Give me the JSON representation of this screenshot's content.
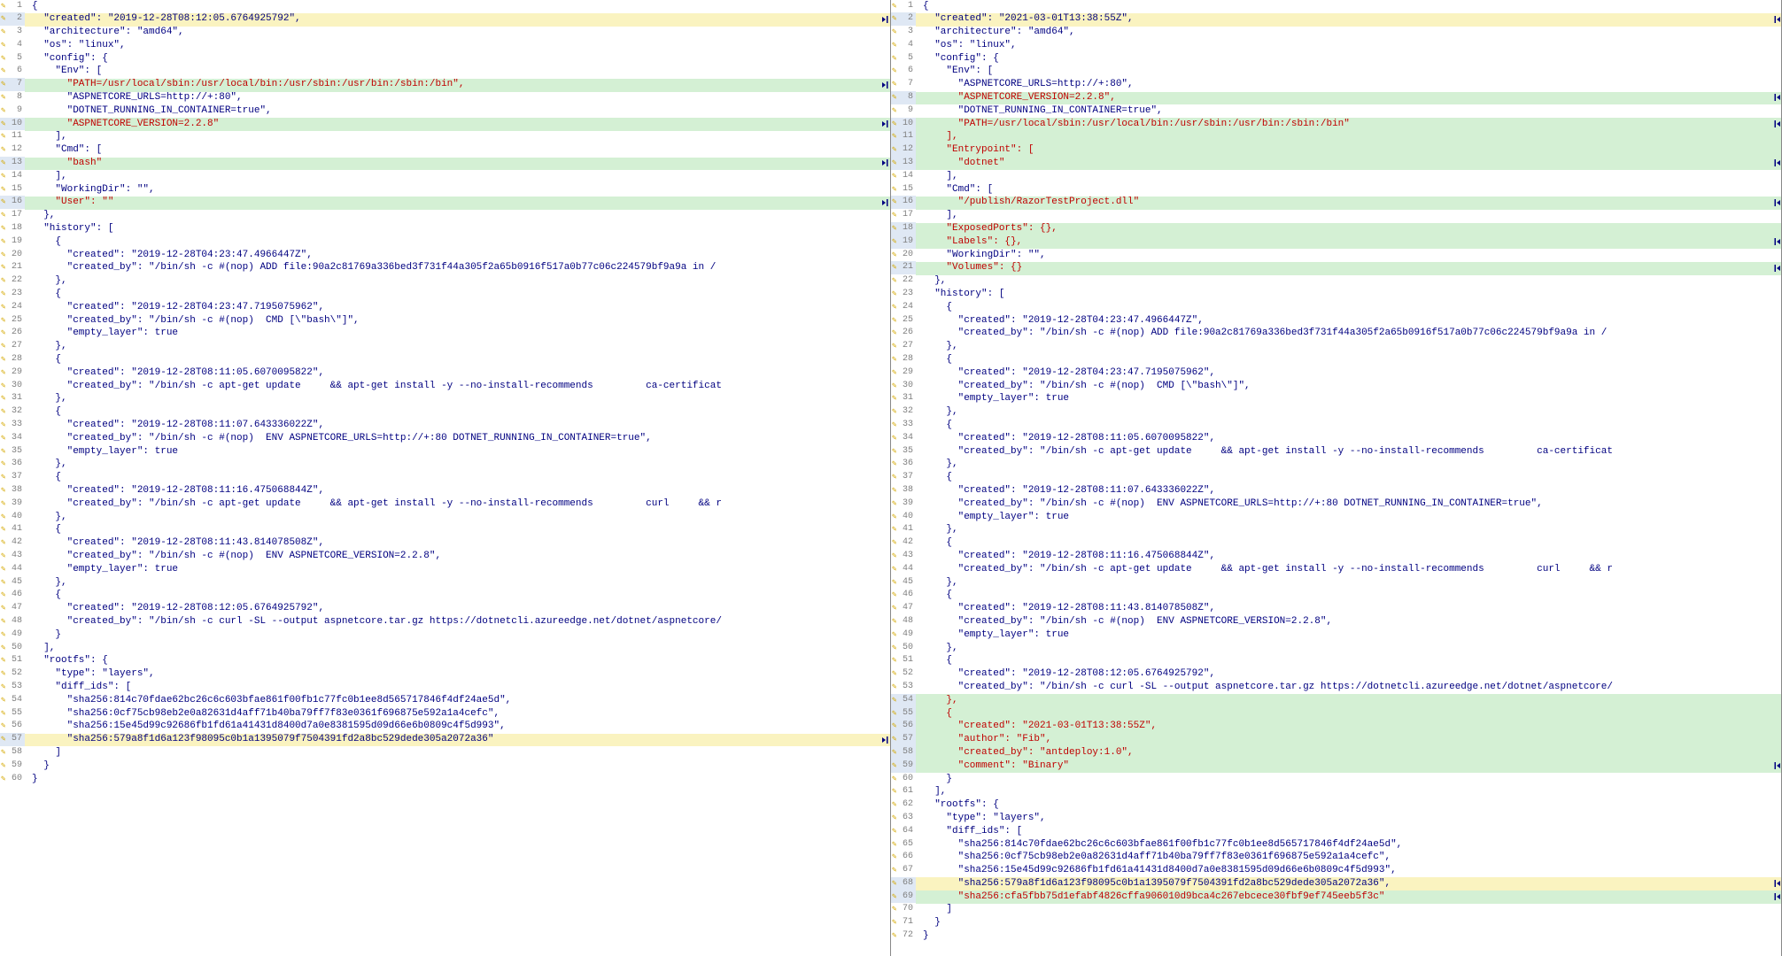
{
  "pencil_glyph": "✎",
  "left": {
    "lines": [
      {
        "n": 1,
        "t": "{",
        "s": "norm"
      },
      {
        "n": 2,
        "t": "  \"created\": \"2019-12-28T08:12:05.6764925792\",",
        "s": "mod",
        "mk": "r"
      },
      {
        "n": 3,
        "t": "  \"architecture\": \"amd64\",",
        "s": "norm"
      },
      {
        "n": 4,
        "t": "  \"os\": \"linux\",",
        "s": "norm"
      },
      {
        "n": 5,
        "t": "  \"config\": {",
        "s": "norm"
      },
      {
        "n": 6,
        "t": "    \"Env\": [",
        "s": "norm"
      },
      {
        "n": 7,
        "t": "      \"PATH=/usr/local/sbin:/usr/local/bin:/usr/sbin:/usr/bin:/sbin:/bin\",",
        "s": "del",
        "mk": "r"
      },
      {
        "n": 8,
        "t": "      \"ASPNETCORE_URLS=http://+:80\",",
        "s": "norm"
      },
      {
        "n": 9,
        "t": "      \"DOTNET_RUNNING_IN_CONTAINER=true\",",
        "s": "norm"
      },
      {
        "n": 10,
        "t": "      \"ASPNETCORE_VERSION=2.2.8\"",
        "s": "del",
        "mk": "r"
      },
      {
        "n": 11,
        "t": "    ],",
        "s": "norm"
      },
      {
        "n": 12,
        "t": "    \"Cmd\": [",
        "s": "norm"
      },
      {
        "n": 13,
        "t": "      \"bash\"",
        "s": "del",
        "mk": "r"
      },
      {
        "n": 14,
        "t": "    ],",
        "s": "norm"
      },
      {
        "n": 15,
        "t": "    \"WorkingDir\": \"\",",
        "s": "norm"
      },
      {
        "n": 16,
        "t": "    \"User\": \"\"",
        "s": "del",
        "mk": "r"
      },
      {
        "n": 17,
        "t": "  },",
        "s": "norm"
      },
      {
        "n": 18,
        "t": "  \"history\": [",
        "s": "norm"
      },
      {
        "n": 19,
        "t": "    {",
        "s": "norm"
      },
      {
        "n": 20,
        "t": "      \"created\": \"2019-12-28T04:23:47.4966447Z\",",
        "s": "norm"
      },
      {
        "n": 21,
        "t": "      \"created_by\": \"/bin/sh -c #(nop) ADD file:90a2c81769a336bed3f731f44a305f2a65b0916f517a0b77c06c224579bf9a9a in /",
        "s": "norm"
      },
      {
        "n": 22,
        "t": "    },",
        "s": "norm"
      },
      {
        "n": 23,
        "t": "    {",
        "s": "norm"
      },
      {
        "n": 24,
        "t": "      \"created\": \"2019-12-28T04:23:47.7195075962\",",
        "s": "norm"
      },
      {
        "n": 25,
        "t": "      \"created_by\": \"/bin/sh -c #(nop)  CMD [\\\"bash\\\"]\",",
        "s": "norm"
      },
      {
        "n": 26,
        "t": "      \"empty_layer\": true",
        "s": "norm"
      },
      {
        "n": 27,
        "t": "    },",
        "s": "norm"
      },
      {
        "n": 28,
        "t": "    {",
        "s": "norm"
      },
      {
        "n": 29,
        "t": "      \"created\": \"2019-12-28T08:11:05.6070095822\",",
        "s": "norm"
      },
      {
        "n": 30,
        "t": "      \"created_by\": \"/bin/sh -c apt-get update     && apt-get install -y --no-install-recommends         ca-certificat",
        "s": "norm"
      },
      {
        "n": 31,
        "t": "    },",
        "s": "norm"
      },
      {
        "n": 32,
        "t": "    {",
        "s": "norm"
      },
      {
        "n": 33,
        "t": "      \"created\": \"2019-12-28T08:11:07.643336022Z\",",
        "s": "norm"
      },
      {
        "n": 34,
        "t": "      \"created_by\": \"/bin/sh -c #(nop)  ENV ASPNETCORE_URLS=http://+:80 DOTNET_RUNNING_IN_CONTAINER=true\",",
        "s": "norm"
      },
      {
        "n": 35,
        "t": "      \"empty_layer\": true",
        "s": "norm"
      },
      {
        "n": 36,
        "t": "    },",
        "s": "norm"
      },
      {
        "n": 37,
        "t": "    {",
        "s": "norm"
      },
      {
        "n": 38,
        "t": "      \"created\": \"2019-12-28T08:11:16.475068844Z\",",
        "s": "norm"
      },
      {
        "n": 39,
        "t": "      \"created_by\": \"/bin/sh -c apt-get update     && apt-get install -y --no-install-recommends         curl     && r",
        "s": "norm"
      },
      {
        "n": 40,
        "t": "    },",
        "s": "norm"
      },
      {
        "n": 41,
        "t": "    {",
        "s": "norm"
      },
      {
        "n": 42,
        "t": "      \"created\": \"2019-12-28T08:11:43.814078508Z\",",
        "s": "norm"
      },
      {
        "n": 43,
        "t": "      \"created_by\": \"/bin/sh -c #(nop)  ENV ASPNETCORE_VERSION=2.2.8\",",
        "s": "norm"
      },
      {
        "n": 44,
        "t": "      \"empty_layer\": true",
        "s": "norm"
      },
      {
        "n": 45,
        "t": "    },",
        "s": "norm"
      },
      {
        "n": 46,
        "t": "    {",
        "s": "norm"
      },
      {
        "n": 47,
        "t": "      \"created\": \"2019-12-28T08:12:05.6764925792\",",
        "s": "norm"
      },
      {
        "n": 48,
        "t": "      \"created_by\": \"/bin/sh -c curl -SL --output aspnetcore.tar.gz https://dotnetcli.azureedge.net/dotnet/aspnetcore/",
        "s": "norm"
      },
      {
        "n": 49,
        "t": "    }",
        "s": "norm"
      },
      {
        "n": 50,
        "t": "  ],",
        "s": "norm"
      },
      {
        "n": 51,
        "t": "  \"rootfs\": {",
        "s": "norm"
      },
      {
        "n": 52,
        "t": "    \"type\": \"layers\",",
        "s": "norm"
      },
      {
        "n": 53,
        "t": "    \"diff_ids\": [",
        "s": "norm"
      },
      {
        "n": 54,
        "t": "      \"sha256:814c70fdae62bc26c6c603bfae861f00fb1c77fc0b1ee8d565717846f4df24ae5d\",",
        "s": "norm"
      },
      {
        "n": 55,
        "t": "      \"sha256:0cf75cb98eb2e0a82631d4aff71b40ba79ff7f83e0361f696875e592a1a4cefc\",",
        "s": "norm"
      },
      {
        "n": 56,
        "t": "      \"sha256:15e45d99c92686fb1fd61a41431d8400d7a0e8381595d09d66e6b0809c4f5d993\",",
        "s": "norm"
      },
      {
        "n": 57,
        "t": "      \"sha256:579a8f1d6a123f98095c0b1a1395079f7504391fd2a8bc529dede305a2072a36\"",
        "s": "mod",
        "mk": "r"
      },
      {
        "n": 58,
        "t": "    ]",
        "s": "norm"
      },
      {
        "n": 59,
        "t": "  }",
        "s": "norm"
      },
      {
        "n": 60,
        "t": "}",
        "s": "norm"
      }
    ]
  },
  "right": {
    "lines": [
      {
        "n": 1,
        "t": "{",
        "s": "norm"
      },
      {
        "n": 2,
        "t": "  \"created\": \"2021-03-01T13:38:55Z\",",
        "s": "mod",
        "mk": "l"
      },
      {
        "n": 3,
        "t": "  \"architecture\": \"amd64\",",
        "s": "norm"
      },
      {
        "n": 4,
        "t": "  \"os\": \"linux\",",
        "s": "norm"
      },
      {
        "n": 5,
        "t": "  \"config\": {",
        "s": "norm"
      },
      {
        "n": 6,
        "t": "    \"Env\": [",
        "s": "norm"
      },
      {
        "n": 7,
        "t": "      \"ASPNETCORE_URLS=http://+:80\",",
        "s": "norm"
      },
      {
        "n": 8,
        "t": "      \"ASPNETCORE_VERSION=2.2.8\",",
        "s": "add",
        "mk": "l"
      },
      {
        "n": 9,
        "t": "      \"DOTNET_RUNNING_IN_CONTAINER=true\",",
        "s": "norm"
      },
      {
        "n": 10,
        "t": "      \"PATH=/usr/local/sbin:/usr/local/bin:/usr/sbin:/usr/bin:/sbin:/bin\"",
        "s": "add",
        "mk": "l"
      },
      {
        "n": 11,
        "t": "    ],",
        "s": "add"
      },
      {
        "n": 12,
        "t": "    \"Entrypoint\": [",
        "s": "add"
      },
      {
        "n": 13,
        "t": "      \"dotnet\"",
        "s": "add",
        "mk": "l"
      },
      {
        "n": 14,
        "t": "    ],",
        "s": "norm"
      },
      {
        "n": 15,
        "t": "    \"Cmd\": [",
        "s": "norm"
      },
      {
        "n": 16,
        "t": "      \"/publish/RazorTestProject.dll\"",
        "s": "add",
        "mk": "l"
      },
      {
        "n": 17,
        "t": "    ],",
        "s": "norm"
      },
      {
        "n": 18,
        "t": "    \"ExposedPorts\": {},",
        "s": "add"
      },
      {
        "n": 19,
        "t": "    \"Labels\": {},",
        "s": "add",
        "mk": "l"
      },
      {
        "n": 20,
        "t": "    \"WorkingDir\": \"\",",
        "s": "norm"
      },
      {
        "n": 21,
        "t": "    \"Volumes\": {}",
        "s": "add",
        "mk": "l"
      },
      {
        "n": 22,
        "t": "  },",
        "s": "norm"
      },
      {
        "n": 23,
        "t": "  \"history\": [",
        "s": "norm"
      },
      {
        "n": 24,
        "t": "    {",
        "s": "norm"
      },
      {
        "n": 25,
        "t": "      \"created\": \"2019-12-28T04:23:47.4966447Z\",",
        "s": "norm"
      },
      {
        "n": 26,
        "t": "      \"created_by\": \"/bin/sh -c #(nop) ADD file:90a2c81769a336bed3f731f44a305f2a65b0916f517a0b77c06c224579bf9a9a in /",
        "s": "norm"
      },
      {
        "n": 27,
        "t": "    },",
        "s": "norm"
      },
      {
        "n": 28,
        "t": "    {",
        "s": "norm"
      },
      {
        "n": 29,
        "t": "      \"created\": \"2019-12-28T04:23:47.7195075962\",",
        "s": "norm"
      },
      {
        "n": 30,
        "t": "      \"created_by\": \"/bin/sh -c #(nop)  CMD [\\\"bash\\\"]\",",
        "s": "norm"
      },
      {
        "n": 31,
        "t": "      \"empty_layer\": true",
        "s": "norm"
      },
      {
        "n": 32,
        "t": "    },",
        "s": "norm"
      },
      {
        "n": 33,
        "t": "    {",
        "s": "norm"
      },
      {
        "n": 34,
        "t": "      \"created\": \"2019-12-28T08:11:05.6070095822\",",
        "s": "norm"
      },
      {
        "n": 35,
        "t": "      \"created_by\": \"/bin/sh -c apt-get update     && apt-get install -y --no-install-recommends         ca-certificat",
        "s": "norm"
      },
      {
        "n": 36,
        "t": "    },",
        "s": "norm"
      },
      {
        "n": 37,
        "t": "    {",
        "s": "norm"
      },
      {
        "n": 38,
        "t": "      \"created\": \"2019-12-28T08:11:07.643336022Z\",",
        "s": "norm"
      },
      {
        "n": 39,
        "t": "      \"created_by\": \"/bin/sh -c #(nop)  ENV ASPNETCORE_URLS=http://+:80 DOTNET_RUNNING_IN_CONTAINER=true\",",
        "s": "norm"
      },
      {
        "n": 40,
        "t": "      \"empty_layer\": true",
        "s": "norm"
      },
      {
        "n": 41,
        "t": "    },",
        "s": "norm"
      },
      {
        "n": 42,
        "t": "    {",
        "s": "norm"
      },
      {
        "n": 43,
        "t": "      \"created\": \"2019-12-28T08:11:16.475068844Z\",",
        "s": "norm"
      },
      {
        "n": 44,
        "t": "      \"created_by\": \"/bin/sh -c apt-get update     && apt-get install -y --no-install-recommends         curl     && r",
        "s": "norm"
      },
      {
        "n": 45,
        "t": "    },",
        "s": "norm"
      },
      {
        "n": 46,
        "t": "    {",
        "s": "norm"
      },
      {
        "n": 47,
        "t": "      \"created\": \"2019-12-28T08:11:43.814078508Z\",",
        "s": "norm"
      },
      {
        "n": 48,
        "t": "      \"created_by\": \"/bin/sh -c #(nop)  ENV ASPNETCORE_VERSION=2.2.8\",",
        "s": "norm"
      },
      {
        "n": 49,
        "t": "      \"empty_layer\": true",
        "s": "norm"
      },
      {
        "n": 50,
        "t": "    },",
        "s": "norm"
      },
      {
        "n": 51,
        "t": "    {",
        "s": "norm"
      },
      {
        "n": 52,
        "t": "      \"created\": \"2019-12-28T08:12:05.6764925792\",",
        "s": "norm"
      },
      {
        "n": 53,
        "t": "      \"created_by\": \"/bin/sh -c curl -SL --output aspnetcore.tar.gz https://dotnetcli.azureedge.net/dotnet/aspnetcore/",
        "s": "norm"
      },
      {
        "n": 54,
        "t": "    },",
        "s": "add"
      },
      {
        "n": 55,
        "t": "    {",
        "s": "add"
      },
      {
        "n": 56,
        "t": "      \"created\": \"2021-03-01T13:38:55Z\",",
        "s": "add"
      },
      {
        "n": 57,
        "t": "      \"author\": \"Fib\",",
        "s": "add"
      },
      {
        "n": 58,
        "t": "      \"created_by\": \"antdeploy:1.0\",",
        "s": "add"
      },
      {
        "n": 59,
        "t": "      \"comment\": \"Binary\"",
        "s": "add",
        "mk": "l"
      },
      {
        "n": 60,
        "t": "    }",
        "s": "norm"
      },
      {
        "n": 61,
        "t": "  ],",
        "s": "norm"
      },
      {
        "n": 62,
        "t": "  \"rootfs\": {",
        "s": "norm"
      },
      {
        "n": 63,
        "t": "    \"type\": \"layers\",",
        "s": "norm"
      },
      {
        "n": 64,
        "t": "    \"diff_ids\": [",
        "s": "norm"
      },
      {
        "n": 65,
        "t": "      \"sha256:814c70fdae62bc26c6c603bfae861f00fb1c77fc0b1ee8d565717846f4df24ae5d\",",
        "s": "norm"
      },
      {
        "n": 66,
        "t": "      \"sha256:0cf75cb98eb2e0a82631d4aff71b40ba79ff7f83e0361f696875e592a1a4cefc\",",
        "s": "norm"
      },
      {
        "n": 67,
        "t": "      \"sha256:15e45d99c92686fb1fd61a41431d8400d7a0e8381595d09d66e6b0809c4f5d993\",",
        "s": "norm"
      },
      {
        "n": 68,
        "t": "      \"sha256:579a8f1d6a123f98095c0b1a1395079f7504391fd2a8bc529dede305a2072a36\",",
        "s": "mod",
        "mk": "l"
      },
      {
        "n": 69,
        "t": "      \"sha256:cfa5fbb75d1efabf4826cffa906010d9bca4c267ebcece30fbf9ef745eeb5f3c\"",
        "s": "add",
        "mk": "l"
      },
      {
        "n": 70,
        "t": "    ]",
        "s": "norm"
      },
      {
        "n": 71,
        "t": "  }",
        "s": "norm"
      },
      {
        "n": 72,
        "t": "}",
        "s": "norm"
      }
    ]
  }
}
